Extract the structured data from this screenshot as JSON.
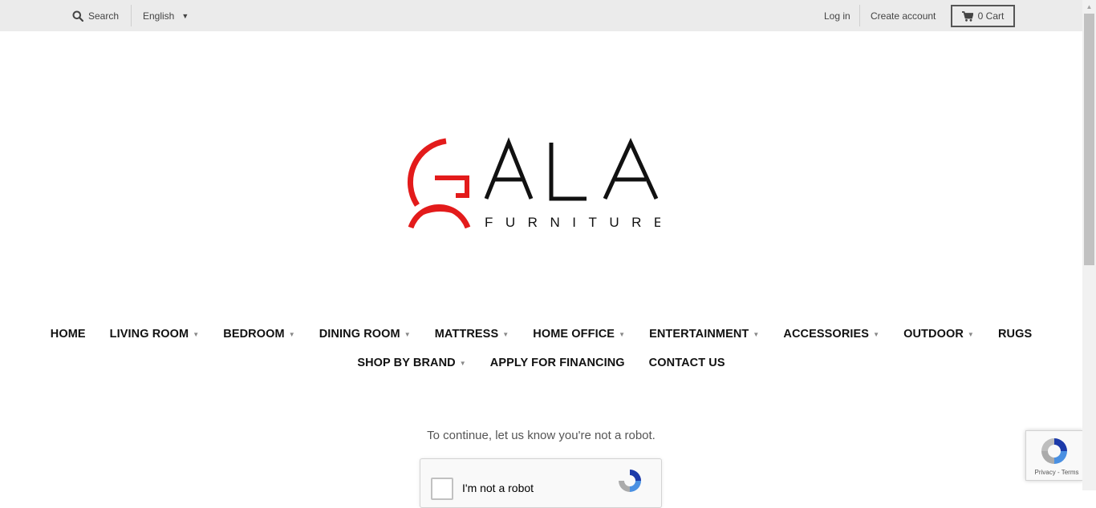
{
  "topbar": {
    "search_label": "Search",
    "language": "English",
    "login": "Log in",
    "create_account": "Create account",
    "cart": "0 Cart"
  },
  "logo": {
    "name": "ALA",
    "tagline": "FURNITURE",
    "accent_color": "#e31b1b",
    "text_color": "#111111"
  },
  "nav": {
    "row1": [
      {
        "label": "HOME",
        "dropdown": false
      },
      {
        "label": "LIVING ROOM",
        "dropdown": true
      },
      {
        "label": "BEDROOM",
        "dropdown": true
      },
      {
        "label": "DINING ROOM",
        "dropdown": true
      },
      {
        "label": "MATTRESS",
        "dropdown": true
      },
      {
        "label": "HOME OFFICE",
        "dropdown": true
      },
      {
        "label": "ENTERTAINMENT",
        "dropdown": true
      },
      {
        "label": "ACCESSORIES",
        "dropdown": true
      },
      {
        "label": "OUTDOOR",
        "dropdown": true
      },
      {
        "label": "RUGS",
        "dropdown": false
      }
    ],
    "row2": [
      {
        "label": "SHOP BY BRAND",
        "dropdown": true
      },
      {
        "label": "APPLY FOR FINANCING",
        "dropdown": false
      },
      {
        "label": "CONTACT US",
        "dropdown": false
      }
    ]
  },
  "captcha": {
    "prompt": "To continue, let us know you're not a robot.",
    "checkbox_label": "I'm not a robot",
    "badge_links": "Privacy - Terms"
  }
}
